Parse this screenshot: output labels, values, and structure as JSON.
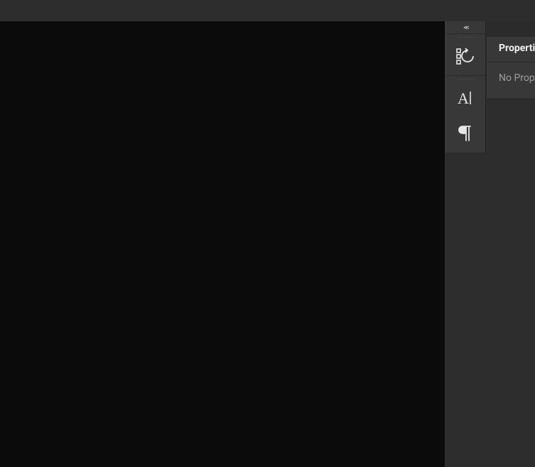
{
  "toolbar": {
    "collapse_glyph": "<<",
    "tools": [
      {
        "id": "last-used",
        "icon": "last-used-icon"
      },
      {
        "id": "character",
        "icon": "character-icon"
      },
      {
        "id": "paragraph",
        "icon": "paragraph-icon"
      }
    ]
  },
  "panel": {
    "title": "Properties",
    "body": "No Properties"
  }
}
